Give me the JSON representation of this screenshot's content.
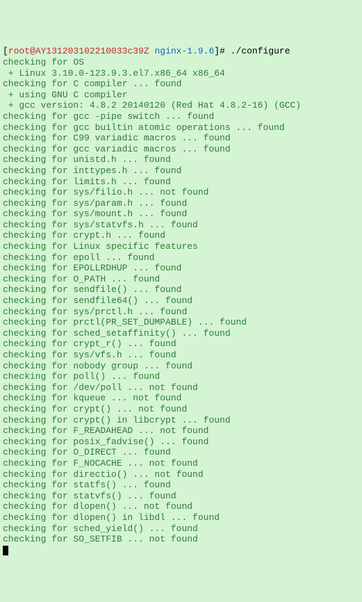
{
  "prompt": {
    "user": "root@AY131203102210033c39Z",
    "path": "nginx-1.9.6",
    "command": "./configure"
  },
  "lines": [
    "checking for OS",
    " + Linux 3.10.0-123.9.3.el7.x86_64 x86_64",
    "checking for C compiler ... found",
    " + using GNU C compiler",
    " + gcc version: 4.8.2 20140120 (Red Hat 4.8.2-16) (GCC)",
    "checking for gcc -pipe switch ... found",
    "checking for gcc builtin atomic operations ... found",
    "checking for C99 variadic macros ... found",
    "checking for gcc variadic macros ... found",
    "checking for unistd.h ... found",
    "checking for inttypes.h ... found",
    "checking for limits.h ... found",
    "checking for sys/filio.h ... not found",
    "checking for sys/param.h ... found",
    "checking for sys/mount.h ... found",
    "checking for sys/statvfs.h ... found",
    "checking for crypt.h ... found",
    "checking for Linux specific features",
    "checking for epoll ... found",
    "checking for EPOLLRDHUP ... found",
    "checking for O_PATH ... found",
    "checking for sendfile() ... found",
    "checking for sendfile64() ... found",
    "checking for sys/prctl.h ... found",
    "checking for prctl(PR_SET_DUMPABLE) ... found",
    "checking for sched_setaffinity() ... found",
    "checking for crypt_r() ... found",
    "checking for sys/vfs.h ... found",
    "checking for nobody group ... found",
    "checking for poll() ... found",
    "checking for /dev/poll ... not found",
    "checking for kqueue ... not found",
    "checking for crypt() ... not found",
    "checking for crypt() in libcrypt ... found",
    "checking for F_READAHEAD ... not found",
    "checking for posix_fadvise() ... found",
    "checking for O_DIRECT ... found",
    "checking for F_NOCACHE ... not found",
    "checking for directio() ... not found",
    "checking for statfs() ... found",
    "checking for statvfs() ... found",
    "checking for dlopen() ... not found",
    "checking for dlopen() in libdl ... found",
    "checking for sched_yield() ... found",
    "checking for SO_SETFIB ... not found"
  ]
}
